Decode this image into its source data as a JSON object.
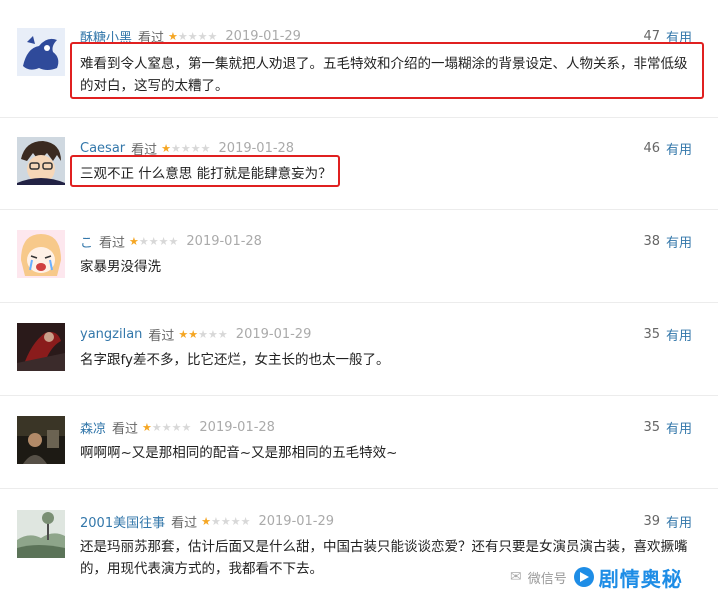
{
  "reviews": [
    {
      "user": "酥糖小黑",
      "status": "看过",
      "stars": 1,
      "date": "2019-01-29",
      "votes": "47",
      "useful": "有用",
      "text": "难看到令人窒息，第一集就把人劝退了。五毛特效和介绍的一塌糊涂的背景设定、人物关系，非常低级的对白，这写的太糟了。",
      "avatar_icon": "blue-cartoon-creature-avatar"
    },
    {
      "user": "Caesar",
      "status": "看过",
      "stars": 1,
      "date": "2019-01-28",
      "votes": "46",
      "useful": "有用",
      "text": "三观不正 什么意思 能打就是能肆意妄为？",
      "avatar_icon": "anime-boy-avatar"
    },
    {
      "user": "こ",
      "status": "看过",
      "stars": 1,
      "date": "2019-01-28",
      "votes": "38",
      "useful": "有用",
      "text": "家暴男没得洗",
      "avatar_icon": "anime-crying-girl-avatar"
    },
    {
      "user": "yangzilan",
      "status": "看过",
      "stars": 2,
      "date": "2019-01-29",
      "votes": "35",
      "useful": "有用",
      "text": "名字跟fy差不多，比它还烂，女主长的也太一般了。",
      "avatar_icon": "dark-red-figure-avatar"
    },
    {
      "user": "森凉",
      "status": "看过",
      "stars": 1,
      "date": "2019-01-28",
      "votes": "35",
      "useful": "有用",
      "text": "啊啊啊~又是那相同的配音~又是那相同的五毛特效~",
      "avatar_icon": "movie-still-avatar"
    },
    {
      "user": "2001美国往事",
      "status": "看过",
      "stars": 1,
      "date": "2019-01-29",
      "votes": "39",
      "useful": "有用",
      "text": "还是玛丽苏那套，估计后面又是什么甜，中国古装只能谈谈恋爱？还有只要是女演员演古装，喜欢撅嘴的，用现代表演方式的，我都看不下去。",
      "avatar_icon": "landscape-photo-avatar"
    }
  ],
  "max_stars": 5,
  "colors": {
    "accent": "#3377aa",
    "star": "#f5a623",
    "highlight": "#e02020",
    "watermark": "#1e8de6"
  },
  "watermark": {
    "small": "微信号",
    "big": "剧情奥秘"
  }
}
